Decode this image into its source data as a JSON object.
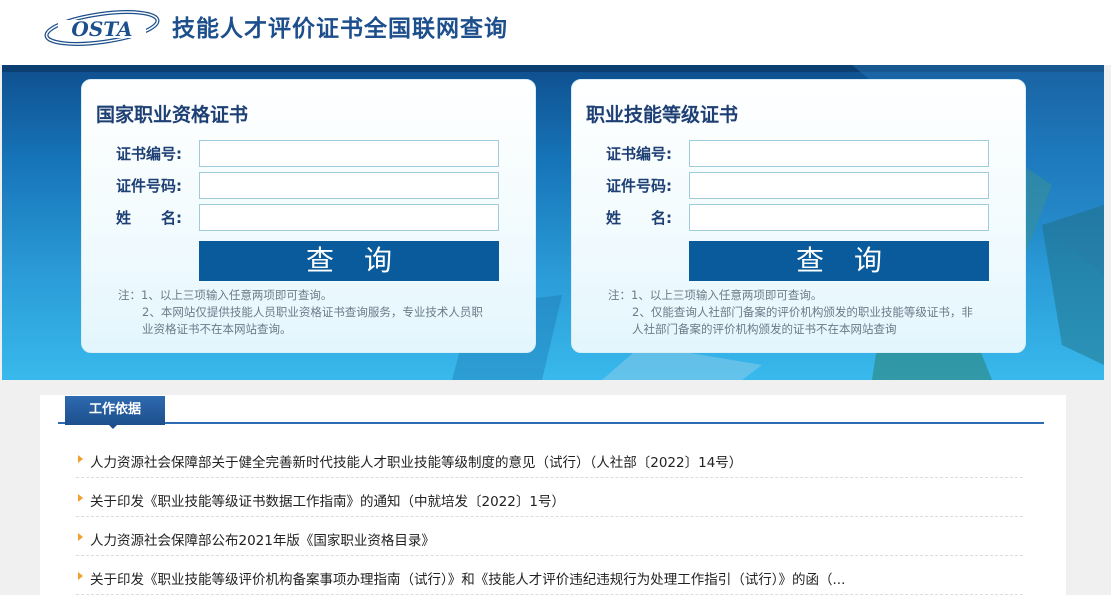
{
  "header": {
    "logo_text": "OSTA",
    "title": "技能人才评价证书全国联网查询"
  },
  "cards": [
    {
      "title": "国家职业资格证书",
      "fields": [
        {
          "label": "证书编号:",
          "value": ""
        },
        {
          "label": "证件号码:",
          "value": ""
        },
        {
          "label": "姓　　名:",
          "value": ""
        }
      ],
      "button": "查询",
      "notes": [
        "注：1、以上三项输入任意两项即可查询。",
        "2、本网站仅提供技能人员职业资格证书查询服务，专业技术人员职",
        "业资格证书不在本网站查询。"
      ]
    },
    {
      "title": "职业技能等级证书",
      "fields": [
        {
          "label": "证书编号:",
          "value": ""
        },
        {
          "label": "证件号码:",
          "value": ""
        },
        {
          "label": "姓　　名:",
          "value": ""
        }
      ],
      "button": "查询",
      "notes": [
        "注：1、以上三项输入任意两项即可查询。",
        "2、仅能查询人社部门备案的评价机构颁发的职业技能等级证书，非",
        "人社部门备案的评价机构颁发的证书不在本网站查询"
      ]
    }
  ],
  "section": {
    "tab": "工作依据",
    "items": [
      "人力资源社会保障部关于健全完善新时代技能人才职业技能等级制度的意见（试行）（人社部〔2022〕14号）",
      "关于印发《职业技能等级证书数据工作指南》的通知（中就培发〔2022〕1号）",
      "人力资源社会保障部公布2021年版《国家职业资格目录》",
      "关于印发《职业技能等级评价机构备案事项办理指南（试行）》和《技能人才评价违纪违规行为处理工作指引（试行）》的函（..."
    ]
  },
  "colors": {
    "brand": "#1d4f8c",
    "button": "#0a5b9c",
    "bullet": "#f0a030"
  }
}
